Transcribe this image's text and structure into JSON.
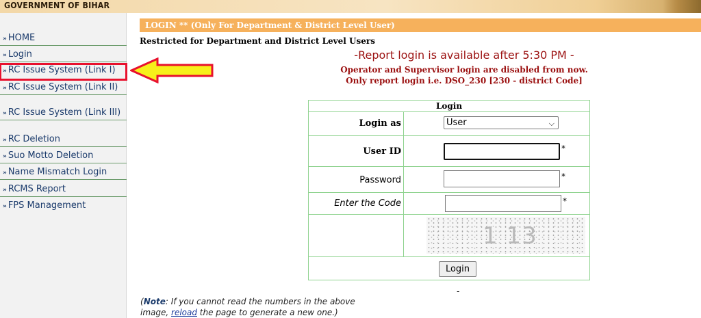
{
  "header": {
    "government": "GOVERNMENT OF BIHAR"
  },
  "sidebar": {
    "bullet": "»",
    "items": [
      {
        "label": "HOME"
      },
      {
        "label": "Login"
      },
      {
        "label": "RC Issue System (Link I)"
      },
      {
        "label": "RC Issue System (Link II)"
      },
      {
        "label": "RC Issue System (Link III)"
      },
      {
        "label": "RC Deletion"
      },
      {
        "label": "Suo Motto Deletion"
      },
      {
        "label": "Name Mismatch Login"
      },
      {
        "label": "RCMS Report"
      },
      {
        "label": "FPS Management"
      }
    ]
  },
  "main": {
    "banner": "LOGIN ** (Only For Department & District Level User)",
    "restricted": "Restricted for Department and District Level Users",
    "report_available": "-Report login is available after 5:30 PM -",
    "operator_notice_1": "Operator and Supervisor login are disabled from now.",
    "operator_notice_2": "Only report login i.e. DSO_230 [230 - district Code]"
  },
  "login_form": {
    "title": "Login",
    "login_as_label": "Login as",
    "login_as_value": "User",
    "user_id_label": "User ID",
    "user_id_value": "",
    "password_label": "Password",
    "password_value": "",
    "code_label": "Enter the Code",
    "code_value": "",
    "required_mark": "*",
    "captcha_text": "1 13",
    "submit_label": "Login"
  },
  "footer": {
    "dash": "-",
    "note_prefix": "(",
    "note_bold": "Note",
    "note_text_1": ": If you cannot read the numbers in the above image, ",
    "note_link": "reload",
    "note_text_2": " the page to generate a new one.)"
  },
  "colors": {
    "banner_bg": "#f6b15c",
    "notice_red": "#9b1010",
    "table_border": "#8fd38f",
    "sidebar_link": "#1a3a6b",
    "highlight_red": "#e8112d",
    "arrow_fill": "#f7f01a"
  }
}
